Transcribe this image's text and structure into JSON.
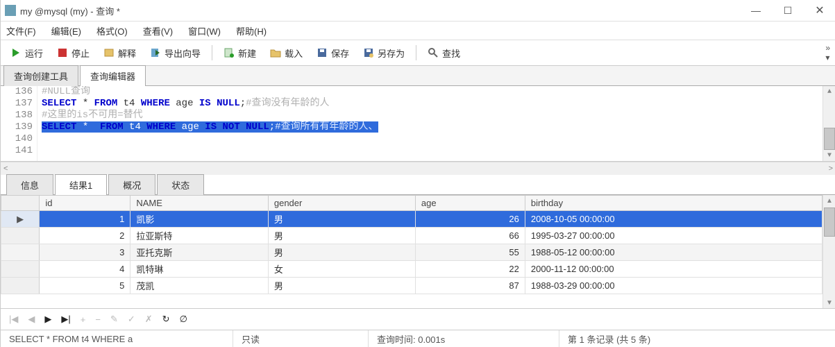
{
  "window": {
    "title": "my @mysql (my) - 查询 *"
  },
  "menu": {
    "file": "文件(F)",
    "edit": "编辑(E)",
    "format": "格式(O)",
    "view": "查看(V)",
    "window": "窗口(W)",
    "help": "帮助(H)"
  },
  "toolbar": {
    "run": "运行",
    "stop": "停止",
    "explain": "解释",
    "export": "导出向导",
    "new": "新建",
    "load": "载入",
    "save": "保存",
    "saveas": "另存为",
    "find": "查找"
  },
  "tabs": {
    "builder": "查询创建工具",
    "editor": "查询编辑器"
  },
  "editor": {
    "lines": [
      {
        "n": "136",
        "tokens": []
      },
      {
        "n": "137",
        "tokens": [
          {
            "t": "#NULL查询",
            "c": "cm"
          }
        ]
      },
      {
        "n": "138",
        "tokens": [
          {
            "t": "SELECT",
            "c": "kw"
          },
          {
            "t": " * "
          },
          {
            "t": "FROM",
            "c": "kw"
          },
          {
            "t": " t4 "
          },
          {
            "t": "WHERE",
            "c": "kw"
          },
          {
            "t": " age "
          },
          {
            "t": "IS",
            "c": "kw"
          },
          {
            "t": " "
          },
          {
            "t": "NULL",
            "c": "kw"
          },
          {
            "t": ";"
          },
          {
            "t": "#查询没有年龄的人",
            "c": "cm"
          }
        ]
      },
      {
        "n": "139",
        "tokens": [
          {
            "t": "#这里的is不可用=替代",
            "c": "cm"
          }
        ]
      },
      {
        "n": "140",
        "sel": true,
        "tokens": [
          {
            "t": "SELECT",
            "c": "kw"
          },
          {
            "t": " * "
          },
          {
            "t": " FROM",
            "c": "kw"
          },
          {
            "t": " t4 "
          },
          {
            "t": "WHERE",
            "c": "kw"
          },
          {
            "t": " age "
          },
          {
            "t": "IS",
            "c": "kw"
          },
          {
            "t": " "
          },
          {
            "t": "NOT",
            "c": "kw"
          },
          {
            "t": " "
          },
          {
            "t": "NULL",
            "c": "kw"
          },
          {
            "t": ";"
          },
          {
            "t": "#查询所有有年龄的人、",
            "c": "cm"
          }
        ]
      },
      {
        "n": "141",
        "tokens": []
      }
    ]
  },
  "resultTabs": {
    "info": "信息",
    "result1": "结果1",
    "profile": "概况",
    "status": "状态"
  },
  "grid": {
    "columns": [
      "id",
      "NAME",
      "gender",
      "age",
      "birthday"
    ],
    "rows": [
      {
        "sel": true,
        "id": "1",
        "NAME": "凯影",
        "gender": "男",
        "age": "26",
        "birthday": "2008-10-05 00:00:00"
      },
      {
        "id": "2",
        "NAME": "拉亚斯特",
        "gender": "男",
        "age": "66",
        "birthday": "1995-03-27 00:00:00"
      },
      {
        "alt": true,
        "id": "3",
        "NAME": "亚托克斯",
        "gender": "男",
        "age": "55",
        "birthday": "1988-05-12 00:00:00"
      },
      {
        "id": "4",
        "NAME": "凯特琳",
        "gender": "女",
        "age": "22",
        "birthday": "2000-11-12 00:00:00"
      },
      {
        "id": "5",
        "NAME": "茂凯",
        "gender": "男",
        "age": "87",
        "birthday": "1988-03-29 00:00:00"
      }
    ]
  },
  "nav": {
    "first": "|◀",
    "prev": "◀",
    "next": "▶",
    "last": "▶|",
    "plus": "+",
    "minus": "−",
    "edit": "✎",
    "check": "✓",
    "cancel": "✗",
    "refresh": "↻",
    "null": "∅"
  },
  "status": {
    "sql": "SELECT * FROM t4 WHERE a",
    "readonly": "只读",
    "time": "查询时间: 0.001s",
    "record": "第 1 条记录 (共 5 条)"
  }
}
